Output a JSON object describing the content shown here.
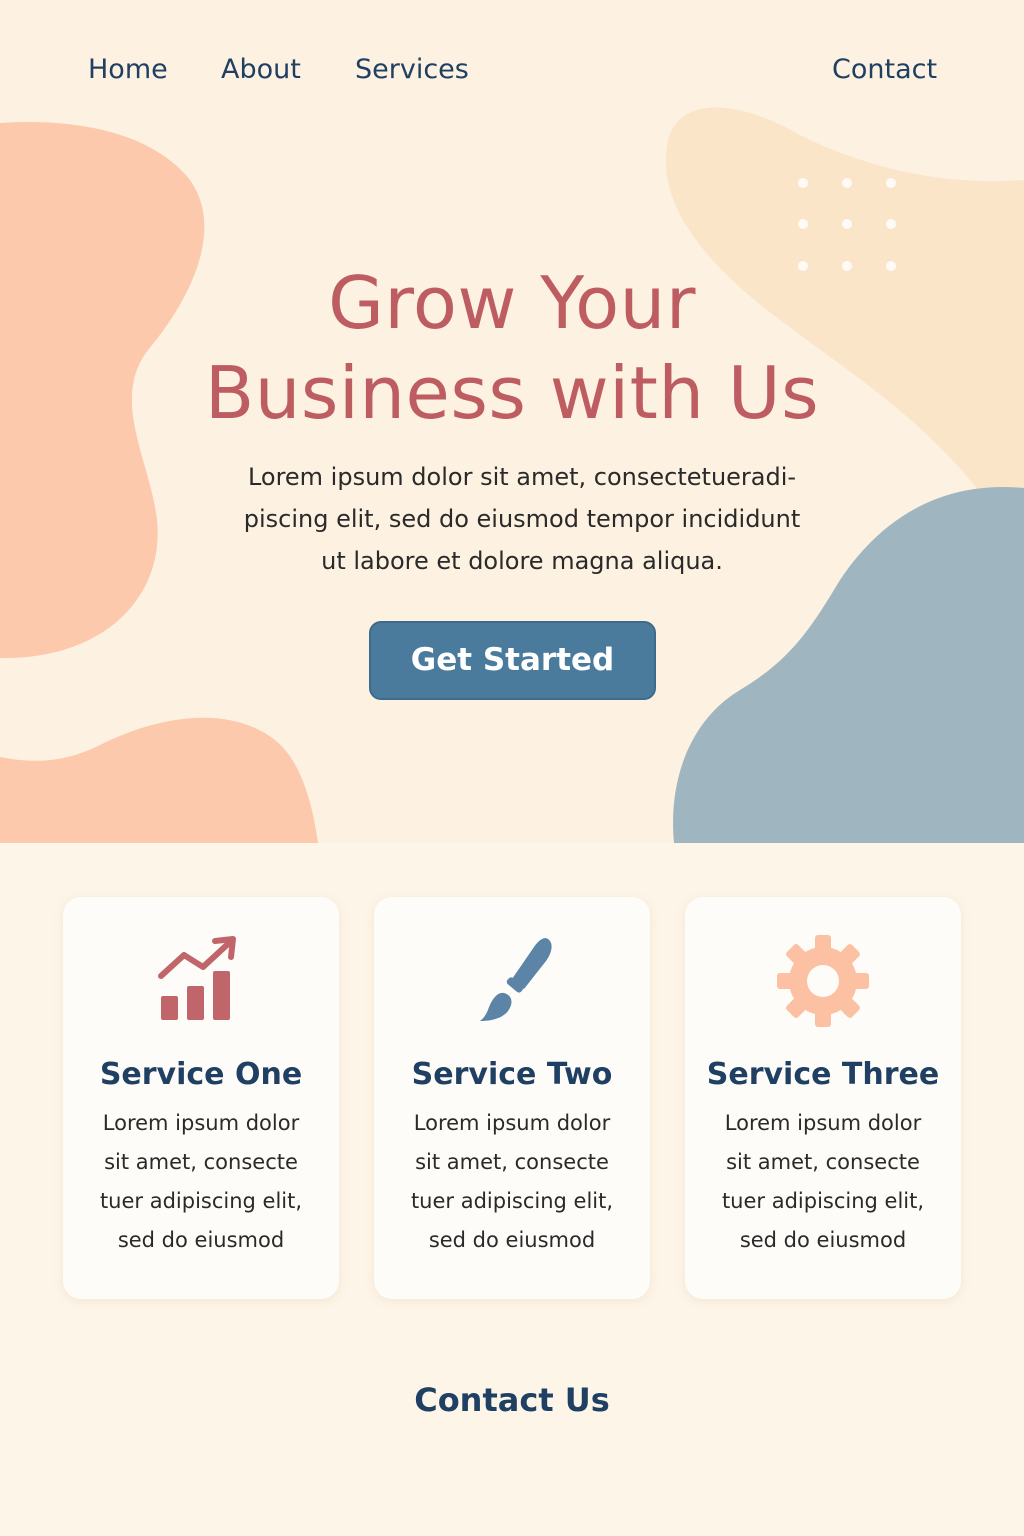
{
  "nav": {
    "home": "Home",
    "about": "About",
    "services": "Services",
    "contact": "Contact"
  },
  "hero": {
    "title_lines": [
      "Grow Your",
      "Business with Us"
    ],
    "subtitle_lines": [
      "Lorem ipsum dolor sit amet, consectetueradi-",
      "piscing elit, sed do eiusmod tempor incididunt",
      "ut labore et dolore magna aliqua."
    ],
    "cta_label": "Get Started"
  },
  "services": [
    {
      "title": "Service One",
      "icon": "growth-chart-icon",
      "body_lines": [
        "Lorem ipsum dolor",
        "sit amet, consecte",
        "tuer adipiscing elit,",
        "sed do eiusmod"
      ]
    },
    {
      "title": "Service Two",
      "icon": "paintbrush-icon",
      "body_lines": [
        "Lorem ipsum dolor",
        "sit amet, consecte",
        "tuer adipiscing elit,",
        "sed do eiusmod"
      ]
    },
    {
      "title": "Service Three",
      "icon": "gear-icon",
      "body_lines": [
        "Lorem ipsum dolor",
        "sit amet, consecte",
        "tuer adipiscing elit,",
        "sed do eiusmod"
      ]
    }
  ],
  "contact_heading": "Contact Us",
  "colors": {
    "background": "#fdf5e8",
    "heading_red": "#bd5c61",
    "navy": "#1f3f63",
    "button_blue": "#4a7b9d",
    "peach": "#fcc9ad",
    "sand": "#fae5c9",
    "slate_blue": "#9fb6c1"
  }
}
